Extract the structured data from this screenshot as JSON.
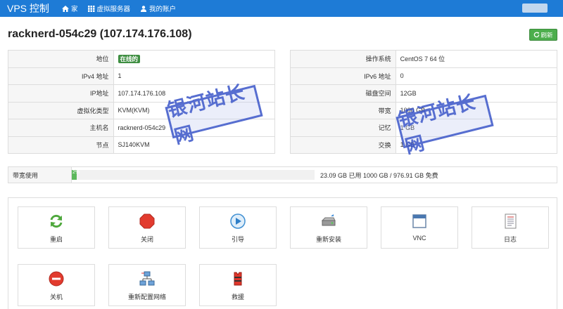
{
  "navbar": {
    "brand": "VPS 控制",
    "items": [
      {
        "label": "家",
        "icon": "home-icon"
      },
      {
        "label": "虚拟服务器",
        "icon": "grid-icon"
      },
      {
        "label": "我的账户",
        "icon": "user-icon"
      }
    ]
  },
  "header": {
    "title": "racknerd-054c29 (107.174.176.108)",
    "refresh_label": "刷新"
  },
  "info_left": [
    {
      "key": "地位",
      "value": "在线的"
    },
    {
      "key": "IPv4 地址",
      "value": "1"
    },
    {
      "key": "IP地址",
      "value": "107.174.176.108"
    },
    {
      "key": "虚拟化类型",
      "value": "KVM(KVM)"
    },
    {
      "key": "主机名",
      "value": "racknerd-054c29"
    },
    {
      "key": "节点",
      "value": "SJ140KVM"
    }
  ],
  "info_right": [
    {
      "key": "操作系统",
      "value": "CentOS 7 64 位"
    },
    {
      "key": "IPv6 地址",
      "value": "0"
    },
    {
      "key": "磁盘空间",
      "value": "12GB"
    },
    {
      "key": "带宽",
      "value": "1000 GB"
    },
    {
      "key": "记忆",
      "value": "1 GB"
    },
    {
      "key": "交换",
      "value": "1 GB"
    }
  ],
  "bandwidth": {
    "label": "带宽使用",
    "percent_label": "2%",
    "percent": 2,
    "text": "23.09 GB 已用 1000 GB / 976.91 GB 免费"
  },
  "actions": [
    {
      "label": "重启",
      "icon": "reboot-icon"
    },
    {
      "label": "关闭",
      "icon": "shutdown-icon"
    },
    {
      "label": "引导",
      "icon": "boot-icon"
    },
    {
      "label": "重新安装",
      "icon": "reinstall-icon"
    },
    {
      "label": "VNC",
      "icon": "vnc-icon"
    },
    {
      "label": "日志",
      "icon": "log-icon"
    },
    {
      "label": "关机",
      "icon": "poweroff-icon"
    },
    {
      "label": "重新配置网络",
      "icon": "network-icon"
    },
    {
      "label": "救援",
      "icon": "rescue-icon"
    }
  ],
  "watermark": "银河站长网",
  "colors": {
    "navbar": "#1e7bd6",
    "success": "#4cae4c",
    "watermark": "#3a55c8"
  }
}
